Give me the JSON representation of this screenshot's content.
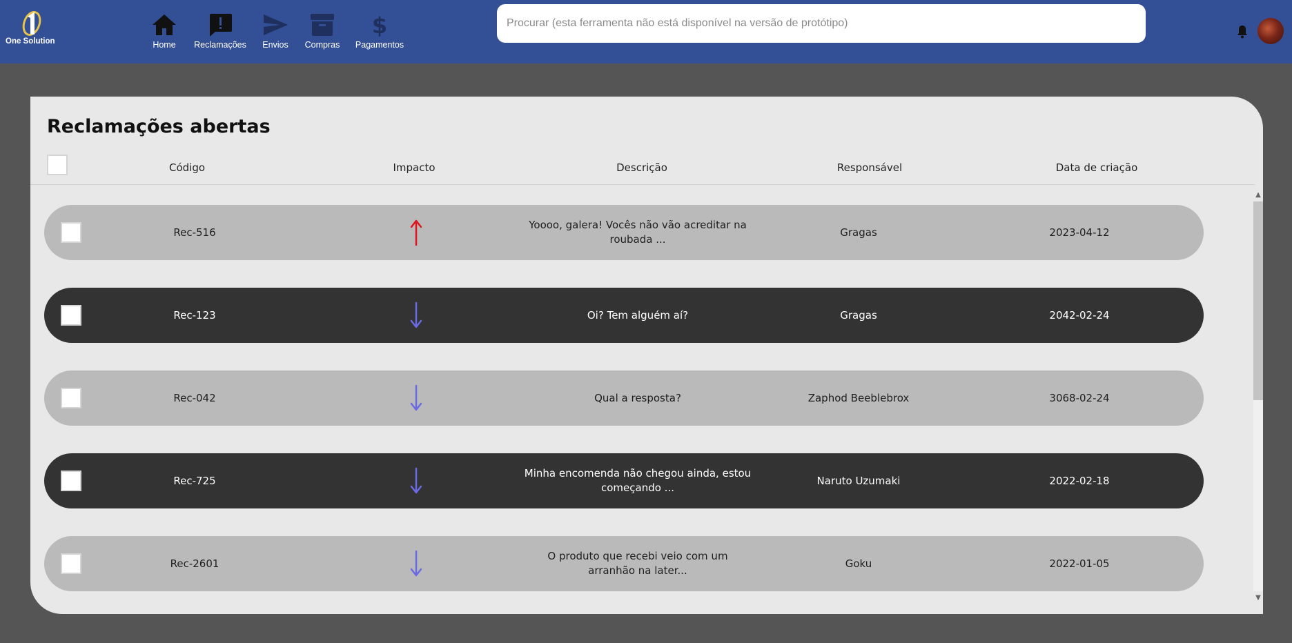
{
  "brand": {
    "name": "One Solution"
  },
  "nav": {
    "items": [
      {
        "label": "Home",
        "icon": "home-icon"
      },
      {
        "label": "Reclamações",
        "icon": "complaint-icon"
      },
      {
        "label": "Envios",
        "icon": "send-icon"
      },
      {
        "label": "Compras",
        "icon": "archive-icon"
      },
      {
        "label": "Pagamentos",
        "icon": "dollar-icon"
      }
    ]
  },
  "search": {
    "placeholder": "Procurar (esta ferramenta não está disponível na versão de protótipo)",
    "value": ""
  },
  "panel": {
    "title": "Reclamações abertas",
    "columns": [
      "Código",
      "Impacto",
      "Descrição",
      "Responsável",
      "Data de criação"
    ]
  },
  "rows": [
    {
      "code": "Rec-516",
      "impact": "up",
      "description": "Yoooo, galera! Vocês não vão acreditar na roubada ...",
      "owner": "Gragas",
      "date": "2023-04-12",
      "theme": "light"
    },
    {
      "code": "Rec-123",
      "impact": "down",
      "description": "Oi? Tem alguém aí?",
      "owner": "Gragas",
      "date": "2042-02-24",
      "theme": "dark"
    },
    {
      "code": "Rec-042",
      "impact": "down",
      "description": "Qual a resposta?",
      "owner": "Zaphod Beeblebrox",
      "date": "3068-02-24",
      "theme": "light"
    },
    {
      "code": "Rec-725",
      "impact": "down",
      "description": "Minha encomenda não chegou ainda, estou começando ...",
      "owner": "Naruto Uzumaki",
      "date": "2022-02-18",
      "theme": "dark"
    },
    {
      "code": "Rec-2601",
      "impact": "down",
      "description": "O produto que recebi veio com um arranhão na later...",
      "owner": "Goku",
      "date": "2022-01-05",
      "theme": "light"
    }
  ],
  "colors": {
    "topbar": "#334f96",
    "background": "#555555",
    "panel": "#e8e8e8",
    "row_light": "#bababa",
    "row_dark": "#333333",
    "impact_up": "#e0141e",
    "impact_down": "#6a6ae6",
    "nav_icon_active": "#111111",
    "nav_icon_inactive": "#1f2f5e"
  }
}
